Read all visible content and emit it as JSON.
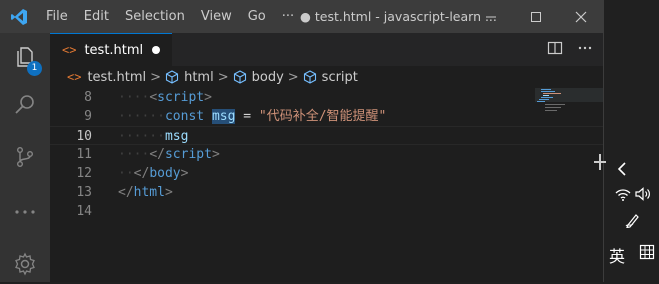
{
  "titlebar": {
    "menu": [
      "File",
      "Edit",
      "Selection",
      "View",
      "Go",
      "···"
    ],
    "title": "● test.html - javascript-learn ..."
  },
  "activity": {
    "explorer_badge": "1"
  },
  "tab": {
    "icon": "<>",
    "label": "test.html"
  },
  "breadcrumb": {
    "file_icon": "<>",
    "items": [
      "test.html",
      "html",
      "body",
      "script"
    ],
    "separator": ">"
  },
  "editor": {
    "lines": [
      {
        "num": "8",
        "indent": "····",
        "parts": [
          {
            "t": "<",
            "c": "br"
          },
          {
            "t": "script",
            "c": "tag"
          },
          {
            "t": ">",
            "c": "br"
          }
        ]
      },
      {
        "num": "9",
        "indent": "······",
        "parts": [
          {
            "t": "const ",
            "c": "kw"
          },
          {
            "t": "msg",
            "c": "var hl"
          },
          {
            "t": " = ",
            "c": "op"
          },
          {
            "t": "\"代码补全/智能提醒\"",
            "c": "str"
          }
        ]
      },
      {
        "num": "10",
        "indent": "······",
        "parts": [
          {
            "t": "msg",
            "c": "var"
          }
        ]
      },
      {
        "num": "11",
        "indent": "····",
        "parts": [
          {
            "t": "</",
            "c": "br"
          },
          {
            "t": "script",
            "c": "tag"
          },
          {
            "t": ">",
            "c": "br"
          }
        ]
      },
      {
        "num": "12",
        "indent": "··",
        "parts": [
          {
            "t": "</",
            "c": "br"
          },
          {
            "t": "body",
            "c": "tag"
          },
          {
            "t": ">",
            "c": "br"
          }
        ]
      },
      {
        "num": "13",
        "indent": "",
        "parts": [
          {
            "t": "</",
            "c": "br"
          },
          {
            "t": "html",
            "c": "tag"
          },
          {
            "t": ">",
            "c": "br"
          }
        ]
      },
      {
        "num": "14",
        "indent": "",
        "parts": []
      }
    ],
    "active_line": "10"
  },
  "ime": {
    "lang": "英",
    "grid_icon": "ime-grid-icon"
  },
  "colors": {
    "accent": "#0078d4",
    "badge": "#0e70c0",
    "tag": "#569cd6",
    "string": "#ce9178",
    "variable": "#9cdcfe"
  }
}
